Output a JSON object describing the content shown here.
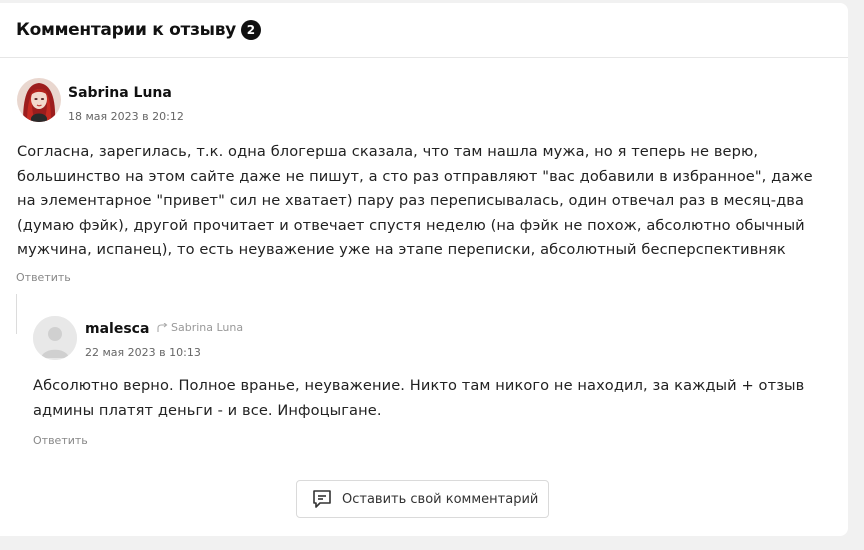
{
  "header": {
    "title": "Комментарии к отзыву",
    "count": "2"
  },
  "comment": {
    "author": "Sabrina Luna",
    "date": "18 мая 2023 в 20:12",
    "text": "Согласна, зарегилась, т.к. одна блогерша сказала, что там нашла мужа, но я теперь не верю, большинство на этом сайте даже не пишут, а сто раз отправляют \"вас добавили в избранное\", даже на элементарное \"привет\" сил не хватает) пару раз переписывалась, один отвечал раз в месяц-два (думаю фэйк), другой прочитает и отвечает спустя неделю (на фэйк не похож, абсолютно обычный мужчина, испанец), то есть неуважение уже на этапе переписки, абсолютный бесперспективняк",
    "reply_label": "Ответить"
  },
  "reply": {
    "author": "malesca",
    "reply_to": "Sabrina Luna",
    "date": "22 мая 2023 в 10:13",
    "text": "Абсолютно верно. Полное вранье, неуважение. Никто там никого не находил, за каждый + отзыв админы платят деньги - и все. Инфоцыгане.",
    "reply_label": "Ответить"
  },
  "footer": {
    "leave_comment_label": "Оставить свой комментарий",
    "icon": "comment-icon"
  },
  "colors": {
    "badge": "#111111",
    "muted": "#888888",
    "border": "#dadada"
  }
}
